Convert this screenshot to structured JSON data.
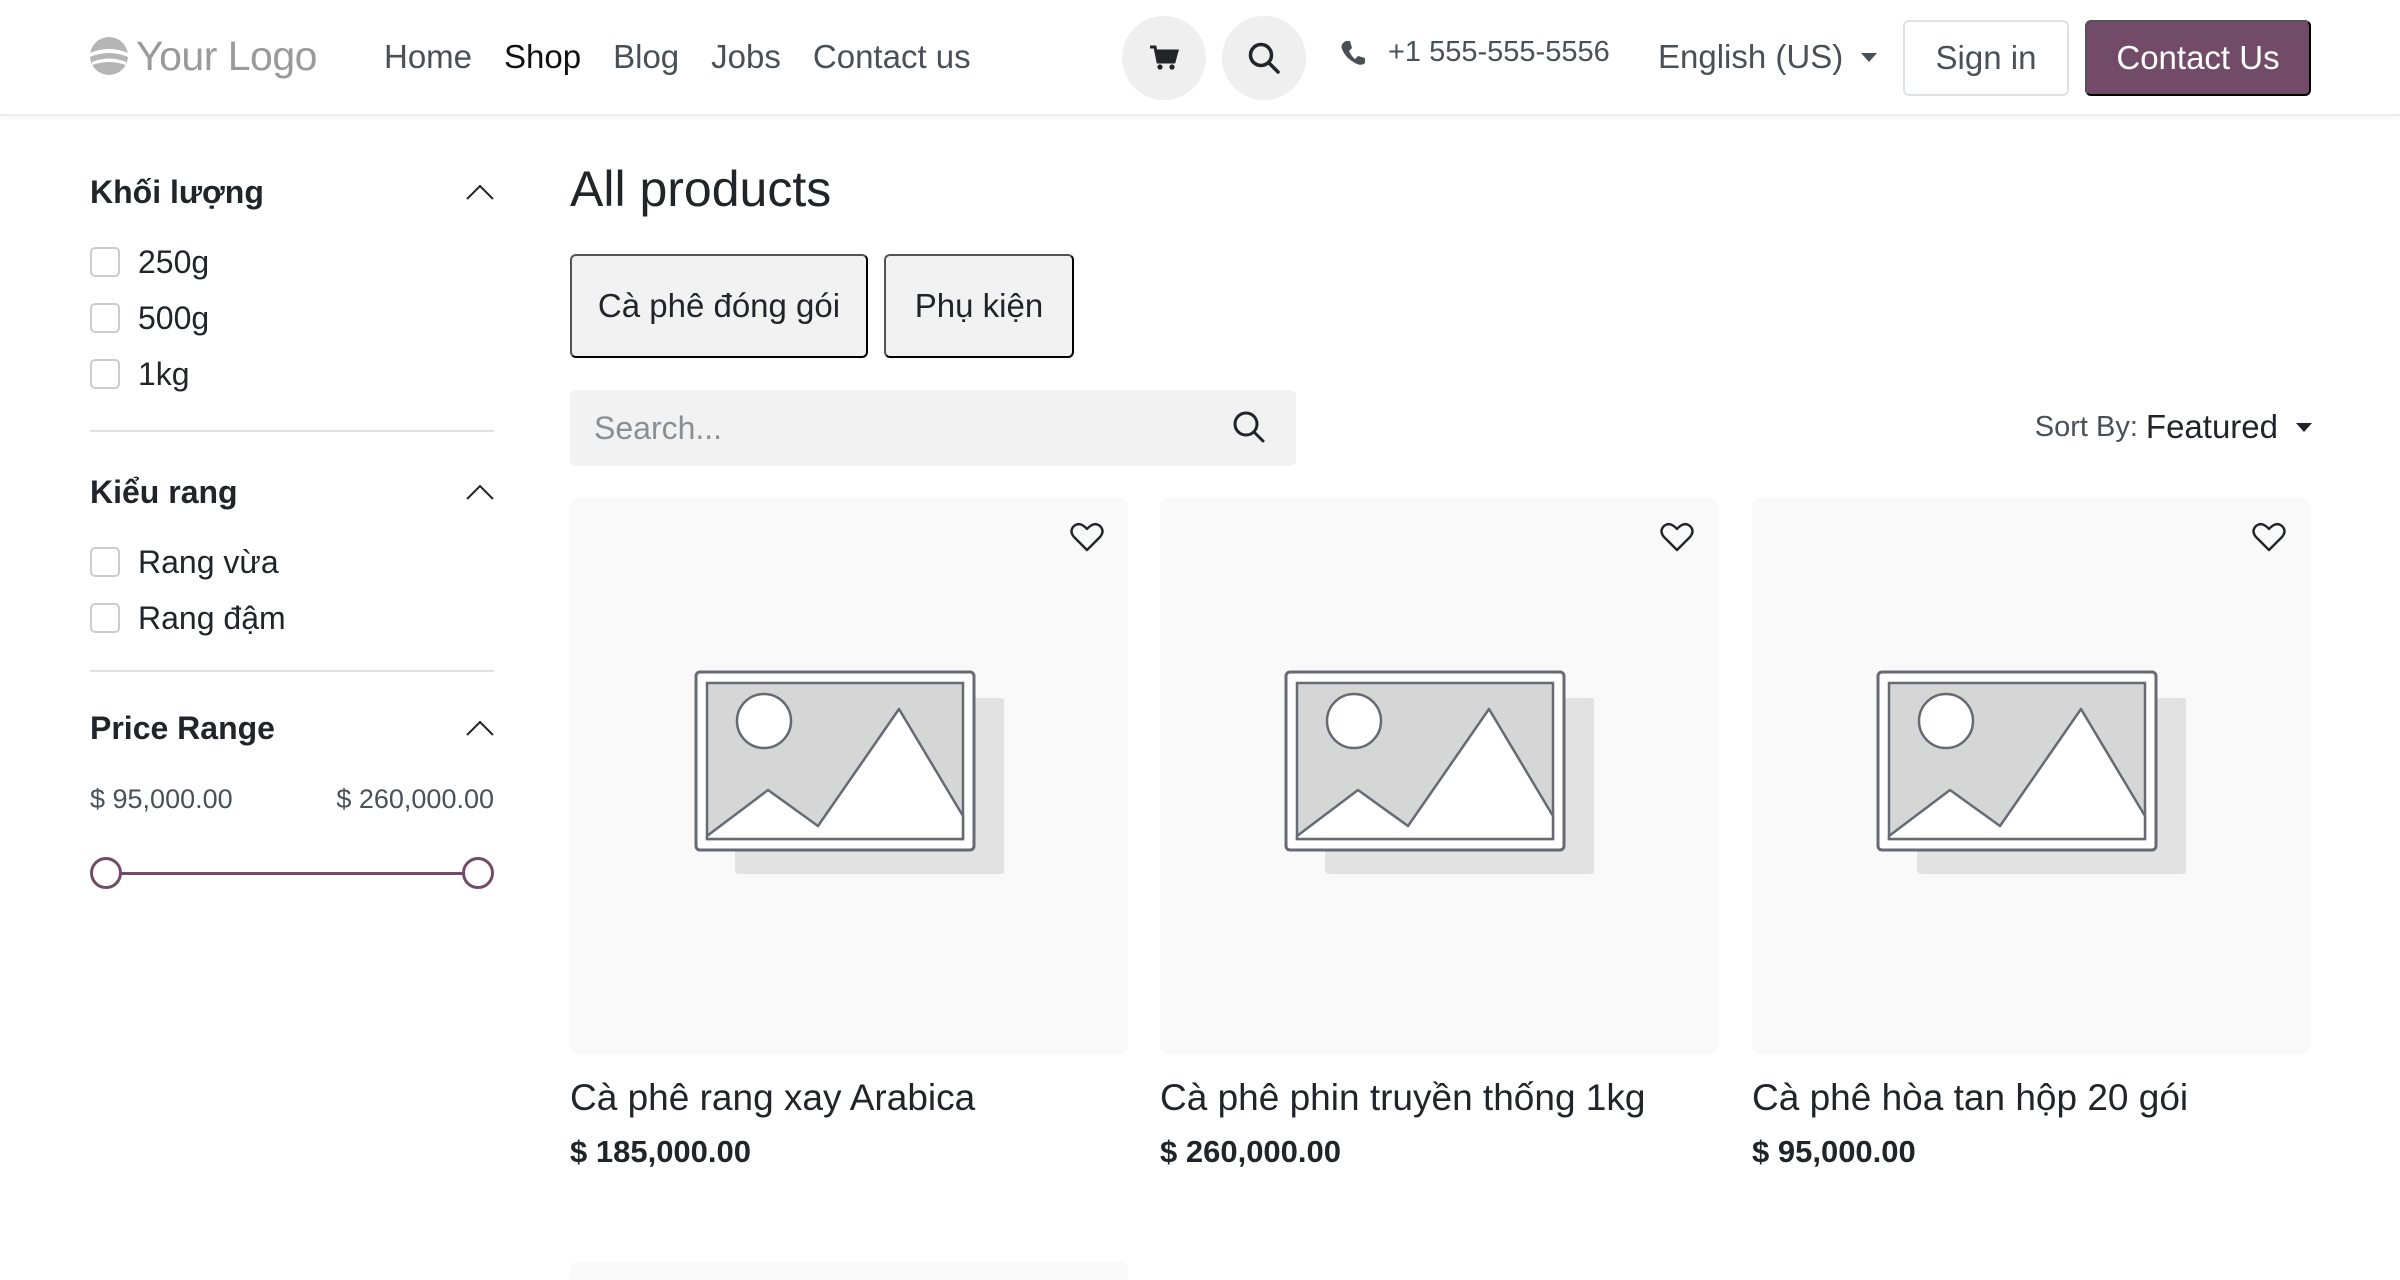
{
  "header": {
    "logo_text": "Your Logo",
    "nav": [
      "Home",
      "Shop",
      "Blog",
      "Jobs",
      "Contact us"
    ],
    "active_nav": "Shop",
    "phone": "+1 555-555-5556",
    "language": "English (US)",
    "sign_in": "Sign in",
    "contact_button": "Contact Us",
    "icons": [
      "cart-icon",
      "search-icon",
      "phone-icon"
    ]
  },
  "sidebar": {
    "filters": [
      {
        "title": "Khối lượng",
        "options": [
          "250g",
          "500g",
          "1kg"
        ]
      },
      {
        "title": "Kiểu rang",
        "options": [
          "Rang vừa",
          "Rang đậm"
        ]
      }
    ],
    "price_range": {
      "title": "Price Range",
      "min": "$ 95,000.00",
      "max": "$ 260,000.00"
    }
  },
  "main": {
    "title": "All products",
    "categories": [
      "Cà phê đóng gói",
      "Phụ kiện"
    ],
    "search_placeholder": "Search...",
    "sort_label": "Sort By:",
    "sort_value": "Featured",
    "products": [
      {
        "name": "Cà phê rang xay Arabica",
        "price": "$ 185,000.00"
      },
      {
        "name": "Cà phê phin truyền thống 1kg",
        "price": "$ 260,000.00"
      },
      {
        "name": "Cà phê hòa tan hộp 20 gói",
        "price": "$ 95,000.00"
      }
    ]
  },
  "colors": {
    "brand": "#714b67",
    "muted_bg": "#f3f2f2"
  }
}
